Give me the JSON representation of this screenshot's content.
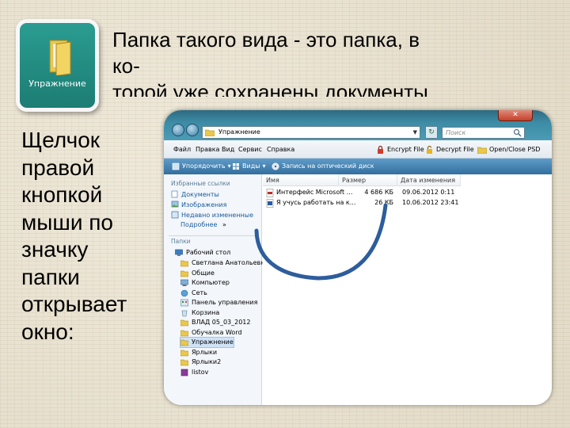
{
  "icon_tile": {
    "label": "Упражнение"
  },
  "heading": {
    "line1": "Папка такого вида  - это папка, в",
    "line2": "ко-",
    "line3": "торой уже сохранены документы."
  },
  "left_text": [
    "Щелчок",
    "правой",
    "кнопкой",
    "мыши по",
    "значку",
    "папки",
    "открывает",
    "окно:"
  ],
  "window": {
    "address": "Упражнение",
    "search_placeholder": "Поиск",
    "menu": [
      "Файл",
      "Правка",
      "Вид",
      "Сервис",
      "Справка"
    ],
    "tools": [
      "Encrypt File",
      "Decrypt File",
      "Open/Close PSD"
    ],
    "commands": [
      "Упорядочить",
      "Виды",
      "Запись на оптический диск"
    ],
    "nav": {
      "favorites_header": "Избранные ссылки",
      "favorites": [
        "Документы",
        "Изображения",
        "Недавно измененные"
      ],
      "more": "Подробнее",
      "more_arrow": "»",
      "folders_header": "Папки",
      "desktop": "Рабочий стол",
      "tree": [
        "Светлана Анатольевна",
        "Общие",
        "Компьютер",
        "Сеть",
        "Панель управления",
        "Корзина",
        "ВЛАД 05_03_2012",
        "Обучалка Word",
        "Упражнение",
        "Ярлыки",
        "Ярлыки2",
        "listov"
      ],
      "selected": "Упражнение"
    },
    "columns": [
      "Имя",
      "Размер",
      "Дата изменения"
    ],
    "files": [
      {
        "name": "Интерфейс Microsoft ...",
        "size": "4 686 КБ",
        "date": "09.06.2012 0:11"
      },
      {
        "name": "Я учусь работать  на к...",
        "size": "26 КБ",
        "date": "10.06.2012 23:41"
      }
    ]
  },
  "colors": {
    "tile": "#1c7d73",
    "titlebar": "#3d8ba4",
    "commandbar": "#336f9e",
    "arc": "#2e5d9c"
  }
}
